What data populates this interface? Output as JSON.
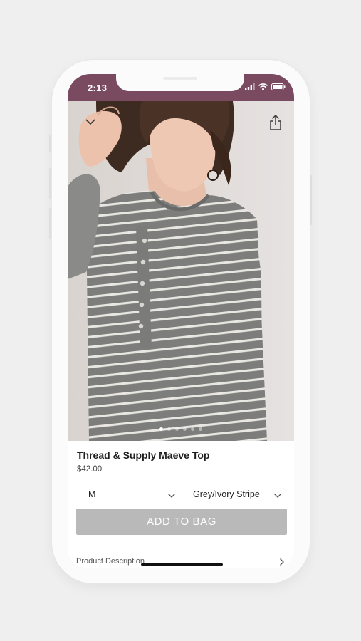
{
  "status_bar": {
    "time": "2:13",
    "background_color": "#7a4a61",
    "icons": [
      "cellular-signal-icon",
      "wifi-icon",
      "battery-icon"
    ]
  },
  "product": {
    "title": "Thread & Supply Maeve Top",
    "price": "$42.00",
    "image_icons": {
      "collapse": "chevron-down-icon",
      "share": "share-icon"
    },
    "carousel": {
      "count": 6,
      "active_index": 1
    }
  },
  "options": {
    "size": {
      "value": "M"
    },
    "color": {
      "value": "Grey/Ivory Stripe"
    }
  },
  "actions": {
    "add_to_bag_label": "ADD TO BAG",
    "add_to_bag_color": "#b9b9b9"
  },
  "details": {
    "description_label": "Product Description"
  }
}
